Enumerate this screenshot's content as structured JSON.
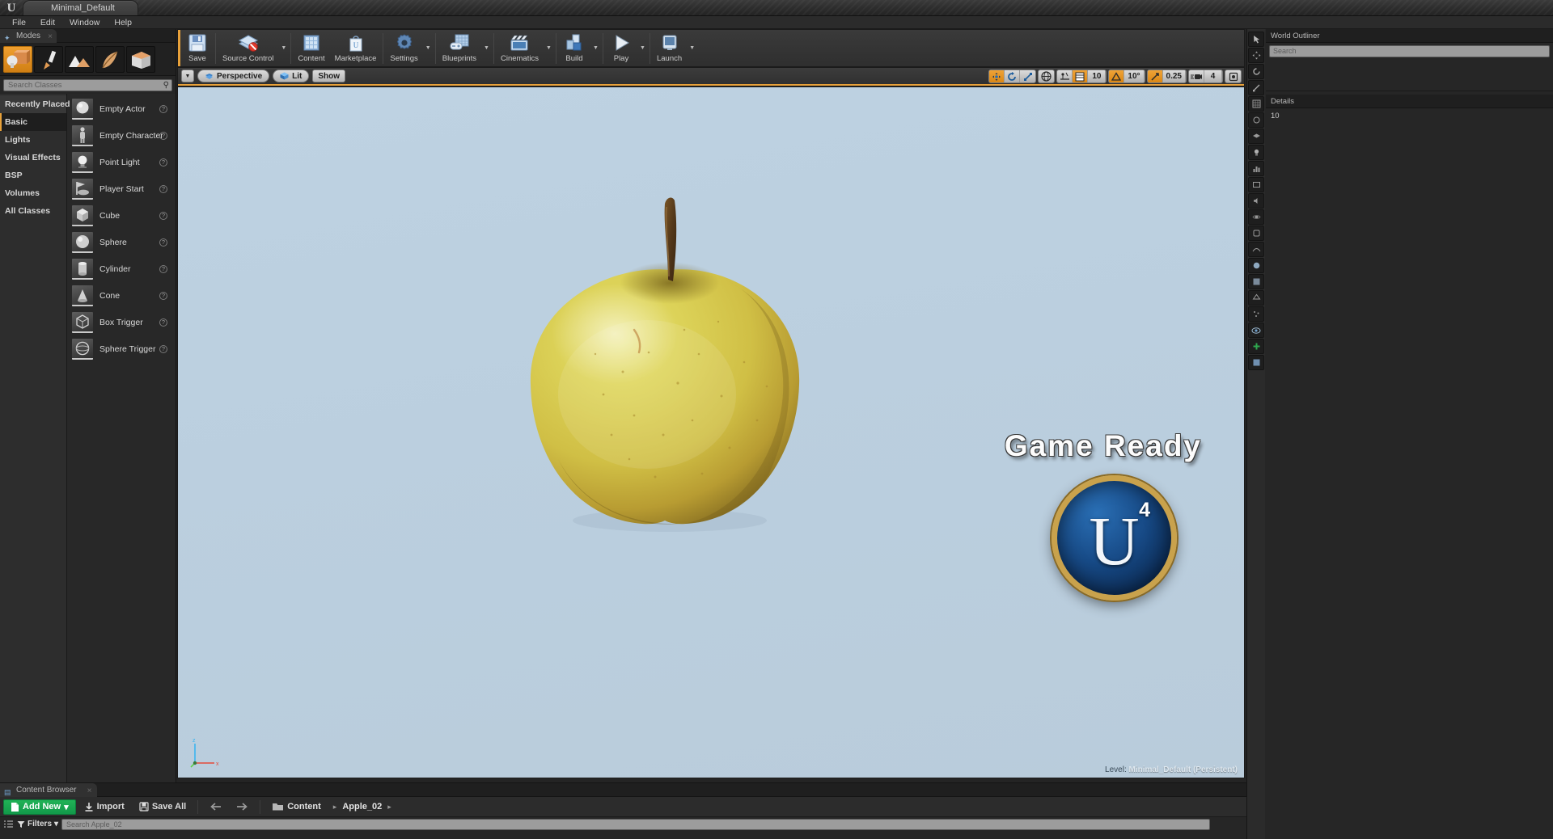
{
  "window": {
    "project_tab": "Minimal_Default",
    "logo_glyph": "U"
  },
  "menubar": {
    "items": [
      {
        "label": "File"
      },
      {
        "label": "Edit"
      },
      {
        "label": "Window"
      },
      {
        "label": "Help"
      }
    ]
  },
  "modes_panel": {
    "tab_label": "Modes",
    "tab_icon": "modes-icon",
    "close_glyph": "×",
    "mode_buttons": [
      {
        "name": "place-mode",
        "selected": true
      },
      {
        "name": "paint-mode",
        "selected": false
      },
      {
        "name": "landscape-mode",
        "selected": false
      },
      {
        "name": "foliage-mode",
        "selected": false
      },
      {
        "name": "geometry-edit-mode",
        "selected": false
      }
    ],
    "search": {
      "placeholder": "Search Classes",
      "value": ""
    },
    "categories": [
      {
        "label": "Recently Placed",
        "active": false,
        "hover": true
      },
      {
        "label": "Basic",
        "active": true,
        "hover": false
      },
      {
        "label": "Lights",
        "active": false,
        "hover": false
      },
      {
        "label": "Visual Effects",
        "active": false,
        "hover": false
      },
      {
        "label": "BSP",
        "active": false,
        "hover": false
      },
      {
        "label": "Volumes",
        "active": false,
        "hover": false
      },
      {
        "label": "All Classes",
        "active": false,
        "hover": false
      }
    ],
    "actors": [
      {
        "label": "Empty Actor",
        "icon": "sphere-actor-icon"
      },
      {
        "label": "Empty Character",
        "icon": "character-icon"
      },
      {
        "label": "Point Light",
        "icon": "lightbulb-icon"
      },
      {
        "label": "Player Start",
        "icon": "player-start-icon"
      },
      {
        "label": "Cube",
        "icon": "cube-icon"
      },
      {
        "label": "Sphere",
        "icon": "sphere-icon"
      },
      {
        "label": "Cylinder",
        "icon": "cylinder-icon"
      },
      {
        "label": "Cone",
        "icon": "cone-icon"
      },
      {
        "label": "Box Trigger",
        "icon": "box-trigger-icon"
      },
      {
        "label": "Sphere Trigger",
        "icon": "sphere-trigger-icon"
      }
    ]
  },
  "main_toolbar": {
    "items": [
      {
        "label": "Save",
        "icon": "floppy-disk-icon",
        "caret": false
      },
      {
        "label": "Source Control",
        "icon": "source-control-icon",
        "caret": true
      },
      {
        "label": "Content",
        "icon": "content-grid-icon",
        "caret": false
      },
      {
        "label": "Marketplace",
        "icon": "marketplace-bag-icon",
        "caret": false
      },
      {
        "label": "Settings",
        "icon": "gear-icon",
        "caret": true
      },
      {
        "label": "Blueprints",
        "icon": "blueprint-icon",
        "caret": true
      },
      {
        "label": "Cinematics",
        "icon": "clapperboard-icon",
        "caret": true
      },
      {
        "label": "Build",
        "icon": "build-blocks-icon",
        "caret": true
      },
      {
        "label": "Play",
        "icon": "play-triangle-icon",
        "caret": true
      },
      {
        "label": "Launch",
        "icon": "launch-device-icon",
        "caret": true
      }
    ]
  },
  "viewport": {
    "view_menu_caret": "▼",
    "perspective_label": "Perspective",
    "perspective_icon": "camera-icon",
    "lit_label": "Lit",
    "lit_icon": "lit-cube-icon",
    "show_label": "Show",
    "snap_toolbar": {
      "transform_modes": [
        {
          "name": "translate-mode-icon",
          "on": true
        },
        {
          "name": "rotate-mode-icon",
          "on": false
        },
        {
          "name": "scale-mode-icon",
          "on": false
        }
      ],
      "coord_system": {
        "name": "world-coordinate-icon",
        "on": false
      },
      "surface_snap": {
        "name": "surface-snap-icon",
        "on": false
      },
      "grid_snap": {
        "name": "grid-snap-icon",
        "on": true,
        "value": "10"
      },
      "rotation_snap": {
        "name": "rotation-snap-icon",
        "on": true,
        "value": "10°"
      },
      "scale_snap": {
        "name": "scale-snap-icon",
        "on": true,
        "value": "0.25"
      },
      "camera_speed": {
        "name": "camera-speed-icon",
        "value": "4"
      },
      "maximize": {
        "name": "maximize-viewport-icon"
      }
    },
    "overlay_text": "Game  Ready",
    "badge": {
      "glyph": "U",
      "version": "4"
    },
    "level_prefix": "Level:",
    "level_name": "Minimal_Default (Persistent)",
    "axis_labels": {
      "z": "z",
      "x": "x",
      "y": "y"
    }
  },
  "content_browser": {
    "tab_label": "Content Browser",
    "tab_icon": "content-browser-icon",
    "close_glyph": "×",
    "add_new_label": "Add New",
    "add_new_caret": "▾",
    "import_label": "Import",
    "import_icon": "import-icon",
    "save_all_label": "Save All",
    "save_all_icon": "save-all-icon",
    "nav_back_icon": "arrow-left-icon",
    "nav_forward_icon": "arrow-right-icon",
    "folder_icon": "folder-icon",
    "breadcrumbs": [
      {
        "label": "Content"
      },
      {
        "label": "Apple_02"
      }
    ],
    "breadcrumb_arrow": "▸",
    "filters_label": "Filters",
    "filters_caret": "▾",
    "search_placeholder": "Search Apple_02"
  },
  "right_panels": {
    "world_outliner_title": "World Outliner",
    "details_title": "Details",
    "search_placeholder": "Search",
    "scene_rows": [
      {
        "label": ""
      },
      {
        "label": ""
      }
    ],
    "tool_icons": [
      "select-tool-icon",
      "translate-tool-icon",
      "rotate-tool-icon",
      "scale-tool-icon",
      "grid-tool-icon",
      "snap-tool-icon",
      "layers-tool-icon",
      "lighting-tool-icon",
      "stats-tool-icon",
      "render-tool-icon",
      "audio-tool-icon",
      "physics-tool-icon",
      "ai-tool-icon",
      "anim-tool-icon",
      "material-tool-icon",
      "texture-tool-icon",
      "mesh-tool-icon",
      "particle-tool-icon"
    ],
    "eye_icon": "eye-icon",
    "plus_icon": "plus-icon",
    "detail_count": "10"
  },
  "colors": {
    "accent_orange": "#e8a13a",
    "green_add": "#18a34d",
    "viewport_bg": "#bbcfdf",
    "panel_bg": "#262626"
  }
}
